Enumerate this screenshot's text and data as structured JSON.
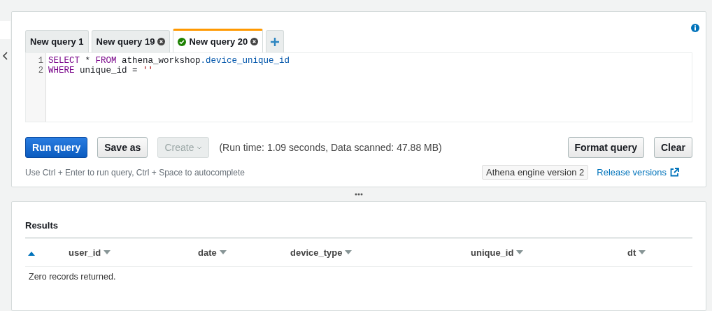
{
  "editor_panel": {
    "tabs": [
      {
        "label": "New query 1",
        "selected": false,
        "closable": false,
        "succeeded": false
      },
      {
        "label": "New query 19",
        "selected": false,
        "closable": true,
        "succeeded": false
      },
      {
        "label": "New query 20",
        "selected": true,
        "closable": true,
        "succeeded": true
      }
    ],
    "lines": [
      {
        "number": "1",
        "tokens": [
          {
            "kind": "keyword",
            "text": "SELECT"
          },
          {
            "kind": "plain",
            "text": " * "
          },
          {
            "kind": "keyword",
            "text": "FROM"
          },
          {
            "kind": "plain",
            "text": " athena_workshop"
          },
          {
            "kind": "ident",
            "text": ".device_unique_id"
          }
        ]
      },
      {
        "number": "2",
        "tokens": [
          {
            "kind": "keyword",
            "text": "WHERE"
          },
          {
            "kind": "plain",
            "text": " unique_id = "
          },
          {
            "kind": "string",
            "text": "''"
          }
        ]
      }
    ],
    "buttons": [
      {
        "label": "Run query",
        "kind": "primary",
        "disabled": false
      },
      {
        "label": "Save as",
        "kind": "normal",
        "disabled": false
      },
      {
        "label": "Create",
        "kind": "dropdown",
        "disabled": true
      }
    ],
    "run_info": "(Run time: 1.09 seconds, Data scanned: 47.88 MB)",
    "right_buttons": [
      {
        "label": "Format query"
      },
      {
        "label": "Clear"
      }
    ],
    "hint": "Use Ctrl + Enter to run query, Ctrl + Space to autocomplete",
    "engine_badge": "Athena engine version 2",
    "release_link": "Release versions"
  },
  "results_panel": {
    "title": "Results",
    "columns": [
      {
        "label": "user_id"
      },
      {
        "label": "date"
      },
      {
        "label": "device_type"
      },
      {
        "label": "unique_id"
      },
      {
        "label": "dt"
      }
    ],
    "empty_message": "Zero records returned."
  }
}
